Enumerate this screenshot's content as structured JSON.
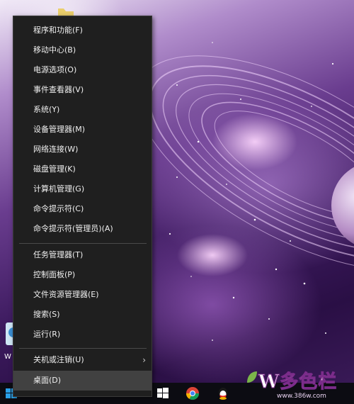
{
  "menu": {
    "items": [
      {
        "label": "程序和功能(F)"
      },
      {
        "label": "移动中心(B)"
      },
      {
        "label": "电源选项(O)"
      },
      {
        "label": "事件查看器(V)"
      },
      {
        "label": "系统(Y)"
      },
      {
        "label": "设备管理器(M)"
      },
      {
        "label": "网络连接(W)"
      },
      {
        "label": "磁盘管理(K)"
      },
      {
        "label": "计算机管理(G)"
      },
      {
        "label": "命令提示符(C)"
      },
      {
        "label": "命令提示符(管理员)(A)"
      },
      {
        "label": "任务管理器(T)"
      },
      {
        "label": "控制面板(P)"
      },
      {
        "label": "文件资源管理器(E)"
      },
      {
        "label": "搜索(S)"
      },
      {
        "label": "运行(R)"
      },
      {
        "label": "关机或注销(U)"
      },
      {
        "label": "桌面(D)"
      }
    ],
    "submenu_arrow": "›",
    "hovered_item": "桌面(D)"
  },
  "desktop": {
    "icon_label": "W"
  },
  "watermark": {
    "text": "W多色栏",
    "url": "www.386w.com"
  },
  "colors": {
    "menu_bg": "#1f1f1f",
    "menu_text": "#f0f0f0",
    "menu_hover": "#414141",
    "taskbar": "#0c0c12"
  }
}
